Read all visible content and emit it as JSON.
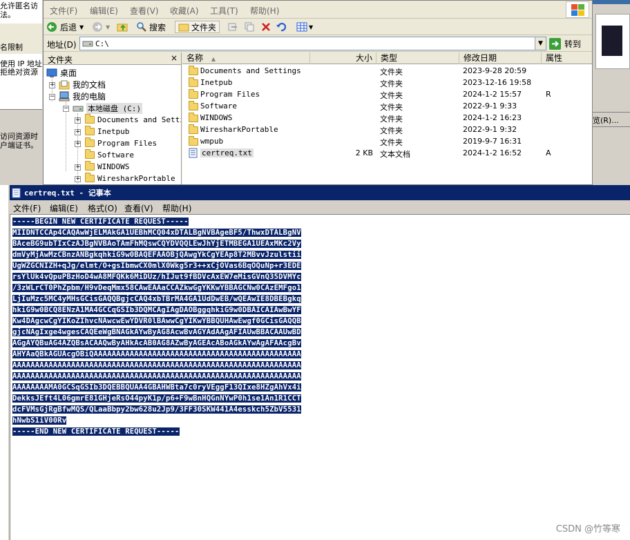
{
  "background_window": {
    "fragments": [
      "允许匿名访",
      "法。",
      "名限制",
      "使用 IP 地址",
      "拒绝对资源",
      "访问资源时",
      "户端证书。"
    ]
  },
  "explorer": {
    "menu": [
      "文件(F)",
      "编辑(E)",
      "查看(V)",
      "收藏(A)",
      "工具(T)",
      "帮助(H)"
    ],
    "toolbar": {
      "back": "后退",
      "search": "搜索",
      "folders": "文件夹"
    },
    "address": {
      "label": "地址(D)",
      "value": "C:\\",
      "go": "转到"
    },
    "folder_pane": {
      "title": "文件夹",
      "close": "×",
      "desktop": "桌面",
      "my_documents": "我的文档",
      "my_computer": "我的电脑",
      "local_disk": "本地磁盘 (C:)",
      "children": [
        "Documents and Setti",
        "Inetpub",
        "Program Files",
        "Software",
        "WINDOWS",
        "WiresharkPortable"
      ]
    },
    "columns": [
      "名称",
      "大小",
      "类型",
      "修改日期",
      "属性"
    ],
    "files": [
      {
        "name": "Documents and Settings",
        "size": "",
        "type": "文件夹",
        "date": "2023-9-28 20:59",
        "attr": ""
      },
      {
        "name": "Inetpub",
        "size": "",
        "type": "文件夹",
        "date": "2023-12-16 19:58",
        "attr": ""
      },
      {
        "name": "Program Files",
        "size": "",
        "type": "文件夹",
        "date": "2024-1-2 15:57",
        "attr": "R"
      },
      {
        "name": "Software",
        "size": "",
        "type": "文件夹",
        "date": "2022-9-1 9:33",
        "attr": ""
      },
      {
        "name": "WINDOWS",
        "size": "",
        "type": "文件夹",
        "date": "2024-1-2 16:23",
        "attr": ""
      },
      {
        "name": "WiresharkPortable",
        "size": "",
        "type": "文件夹",
        "date": "2022-9-1 9:32",
        "attr": ""
      },
      {
        "name": "wmpub",
        "size": "",
        "type": "文件夹",
        "date": "2019-9-7 16:31",
        "attr": ""
      },
      {
        "name": "certreq.txt",
        "size": "2 KB",
        "type": "文本文档",
        "date": "2024-1-2 16:52",
        "attr": "A"
      }
    ]
  },
  "right_strip": {
    "fragment": "览(R)..."
  },
  "notepad": {
    "title": "certreq.txt - 记事本",
    "menu": [
      "文件(F)",
      "编辑(E)",
      "格式(O)",
      "查看(V)",
      "帮助(H)"
    ],
    "lines": [
      "-----BEGIN NEW CERTIFICATE REQUEST-----",
      "MIIDNTCCAp4CAQAwWjELMAkGA1UEBhMCQ04xDTALBgNVBAgeBF5/ThwxDTALBgNV",
      "BAceBG9ubTIxCzAJBgNVBAoTAmFhMQswCQYDVQQLEwJhYjETMBEGA1UEAxMKc2Vy",
      "dmVyMjAwMzCBnzANBgkqhkiG9w0BAQEFAAOBjQAwgYkCgYEAp8T2MBvvJzulstii",
      "UgWZGCNIZH+qJg/elmt/O+gsIbmwCX0mlX0Wkg5r3++xCjOVas6BqOQuNp+r3EDE",
      "rsYlUk4vQpuPBzHoD4wA8MFQKk6MiDUz/hIJut9fBDVcAxEW7eMisGVnQ35DVMYc",
      "/3zWLrCT0PhZpbm/H9vDeqMmx58CAwEAAaCCAZkwGgYKKwYBBAGCNw0CAzEMFgo1",
      "LjIuMzc5MC4yMHsGCisGAQQBgjcCAQ4xbTBrMA4GA1UdDwEB/wQEAwIE8DBEBgkq",
      "hkiG9w0BCQ8ENzA1MA4GCCqGSIb3DQMCAgIAgDAOBggqhkiG9w0DBAICAIAwBwYF",
      "Kw4DAgcwCgYIKoZIhvcNAwcwEwYDVR0lBAwwCgYIKwYBBQUHAwEwgf0GCisGAQQB",
      "gjcNAgIxge4wgesCAQEeWgBNAGkAYwByAG8AcwBvAGYAdAAgAFIAUwBBACAAUwBD",
      "AGgAYQBuAG4AZQBsACAAQwByAHkAcAB0AG8AZwByAGEAcABoAGkAYwAgAFAAcgBv",
      "AHYAaQBkAGUAcgOBiQAAAAAAAAAAAAAAAAAAAAAAAAAAAAAAAAAAAAAAAAAAAAAA",
      "AAAAAAAAAAAAAAAAAAAAAAAAAAAAAAAAAAAAAAAAAAAAAAAAAAAAAAAAAAAAAAAA",
      "AAAAAAAAAAAAAAAAAAAAAAAAAAAAAAAAAAAAAAAAAAAAAAAAAAAAAAAAAAAAAAAA",
      "AAAAAAAAMA0GCSqGSIb3DQEBBQUAA4GBAHWBta7c0ryVEggF13QIxe8HZgAhVx4i",
      "DekksJEft4L06gmrE81GHjeRsO44pyK1p/p6+F9wBnHQGnNYwP0h1se1An1R1CCT",
      "dcFVMsGjRgBfwMQS/QLaaBbpy2bw628u2Jp9/3FF30SKW441A4esskch5ZbV5531",
      "hNwbS1iV00Rv",
      "-----END NEW CERTIFICATE REQUEST-----"
    ]
  },
  "watermark": "CSDN @竹等寒"
}
